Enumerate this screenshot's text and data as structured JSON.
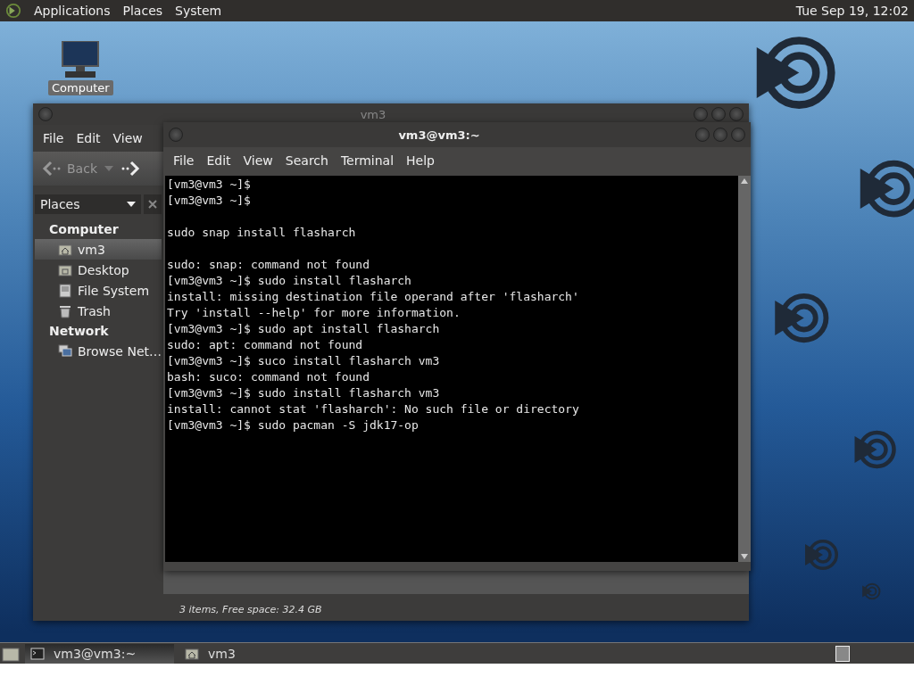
{
  "top_panel": {
    "menus": [
      "Applications",
      "Places",
      "System"
    ],
    "clock": "Tue Sep 19, 12:02"
  },
  "desktop_icons": [
    {
      "label": "Computer"
    }
  ],
  "file_manager": {
    "title": "vm3",
    "menu": [
      "File",
      "Edit",
      "View"
    ],
    "toolbar": {
      "back": "Back"
    },
    "sidebar": {
      "header": "Places",
      "sections": [
        {
          "title": "Computer",
          "items": [
            {
              "label": "vm3",
              "kind": "home",
              "selected": true
            },
            {
              "label": "Desktop",
              "kind": "folder",
              "selected": false
            },
            {
              "label": "File System",
              "kind": "drive",
              "selected": false
            },
            {
              "label": "Trash",
              "kind": "trash",
              "selected": false
            }
          ]
        },
        {
          "title": "Network",
          "items": [
            {
              "label": "Browse Net…",
              "kind": "network",
              "selected": false
            }
          ]
        }
      ]
    },
    "status": "3 items, Free space: 32.4 GB"
  },
  "terminal": {
    "title": "vm3@vm3:~",
    "menu": [
      "File",
      "Edit",
      "View",
      "Search",
      "Terminal",
      "Help"
    ],
    "lines": [
      {
        "text": "[vm3@vm3 ~]$",
        "blank_before": false
      },
      {
        "text": "[vm3@vm3 ~]$",
        "blank_before": false
      },
      {
        "text": "sudo snap install flasharch",
        "blank_before": true
      },
      {
        "text": "sudo: snap: command not found",
        "blank_before": true
      },
      {
        "text": "[vm3@vm3 ~]$ sudo install flasharch",
        "blank_before": false
      },
      {
        "text": "install: missing destination file operand after 'flasharch'",
        "blank_before": false
      },
      {
        "text": "Try 'install --help' for more information.",
        "blank_before": false
      },
      {
        "text": "[vm3@vm3 ~]$ sudo apt install flasharch",
        "blank_before": false
      },
      {
        "text": "sudo: apt: command not found",
        "blank_before": false
      },
      {
        "text": "[vm3@vm3 ~]$ suco install flasharch vm3",
        "blank_before": false
      },
      {
        "text": "bash: suco: command not found",
        "blank_before": false
      },
      {
        "text": "[vm3@vm3 ~]$ sudo install flasharch vm3",
        "blank_before": false
      },
      {
        "text": "install: cannot stat 'flasharch': No such file or directory",
        "blank_before": false
      },
      {
        "text": "[vm3@vm3 ~]$ sudo pacman -S jdk17-op",
        "blank_before": false
      }
    ]
  },
  "taskbar": {
    "tasks": [
      {
        "label": "vm3@vm3:~",
        "kind": "terminal",
        "selected": true
      },
      {
        "label": "vm3",
        "kind": "folder",
        "selected": false
      }
    ]
  }
}
